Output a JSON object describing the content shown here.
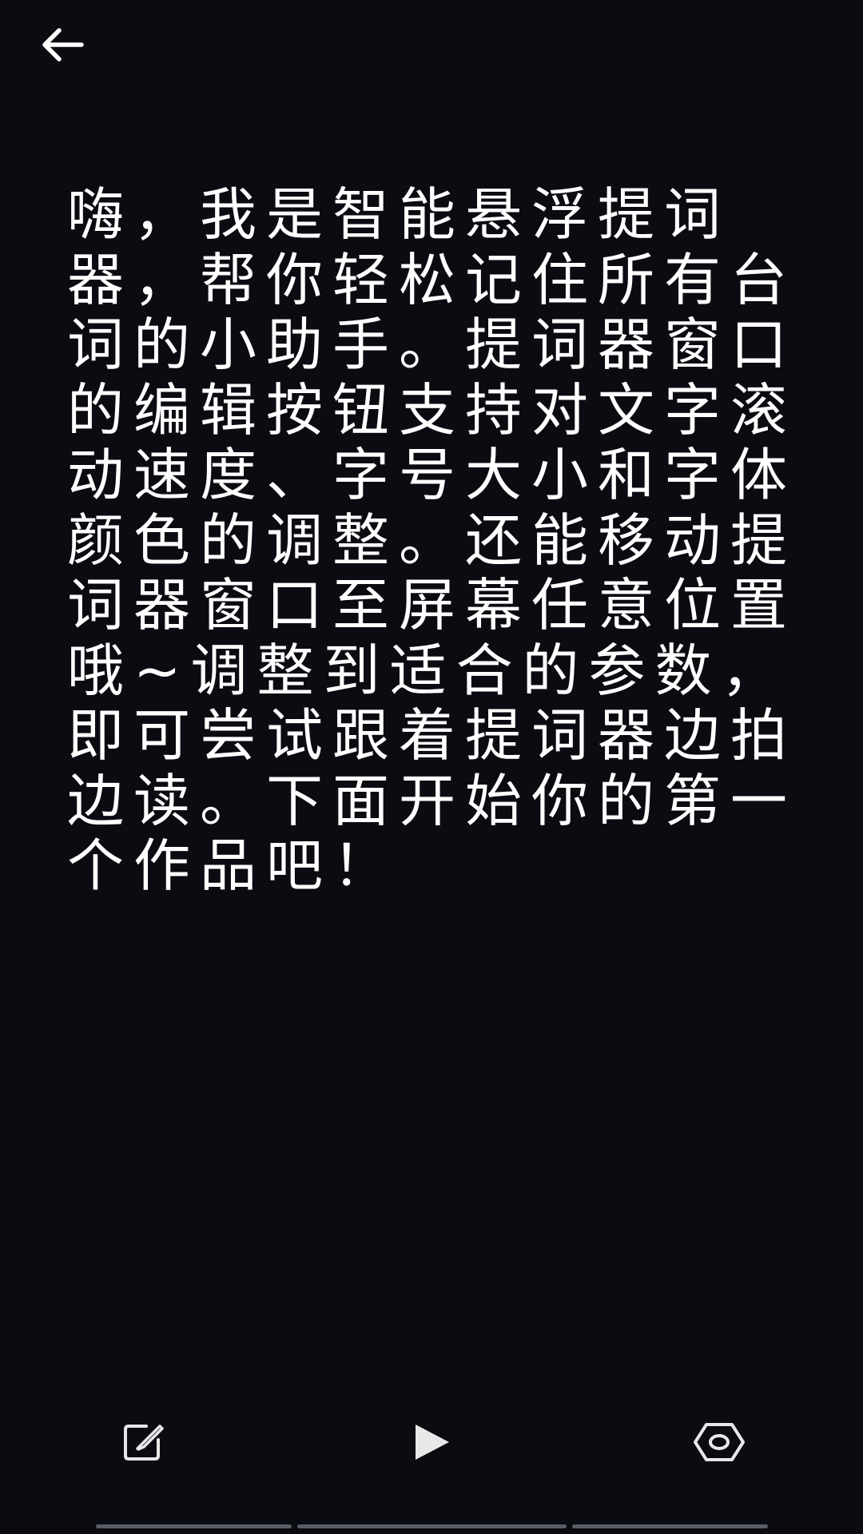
{
  "colors": {
    "background": "#0b0c12",
    "text": "#ffffff",
    "icon": "#e8e8e8",
    "bar": "#5a5d66"
  },
  "top_bar": {
    "back_icon": "arrow-left-icon"
  },
  "script": {
    "text": "嗨，我是智能悬浮提词器，帮你轻松记住所有台词的小助手。提词器窗口的编辑按钮支持对文字滚动速度、字号大小和字体颜色的调整。还能移动提词器窗口至屏幕任意位置哦~调整到适合的参数，即可尝试跟着提词器边拍边读。下面开始你的第一个作品吧！"
  },
  "toolbar": {
    "edit_icon": "edit-icon",
    "play_icon": "play-icon",
    "preview_icon": "eye-icon"
  }
}
